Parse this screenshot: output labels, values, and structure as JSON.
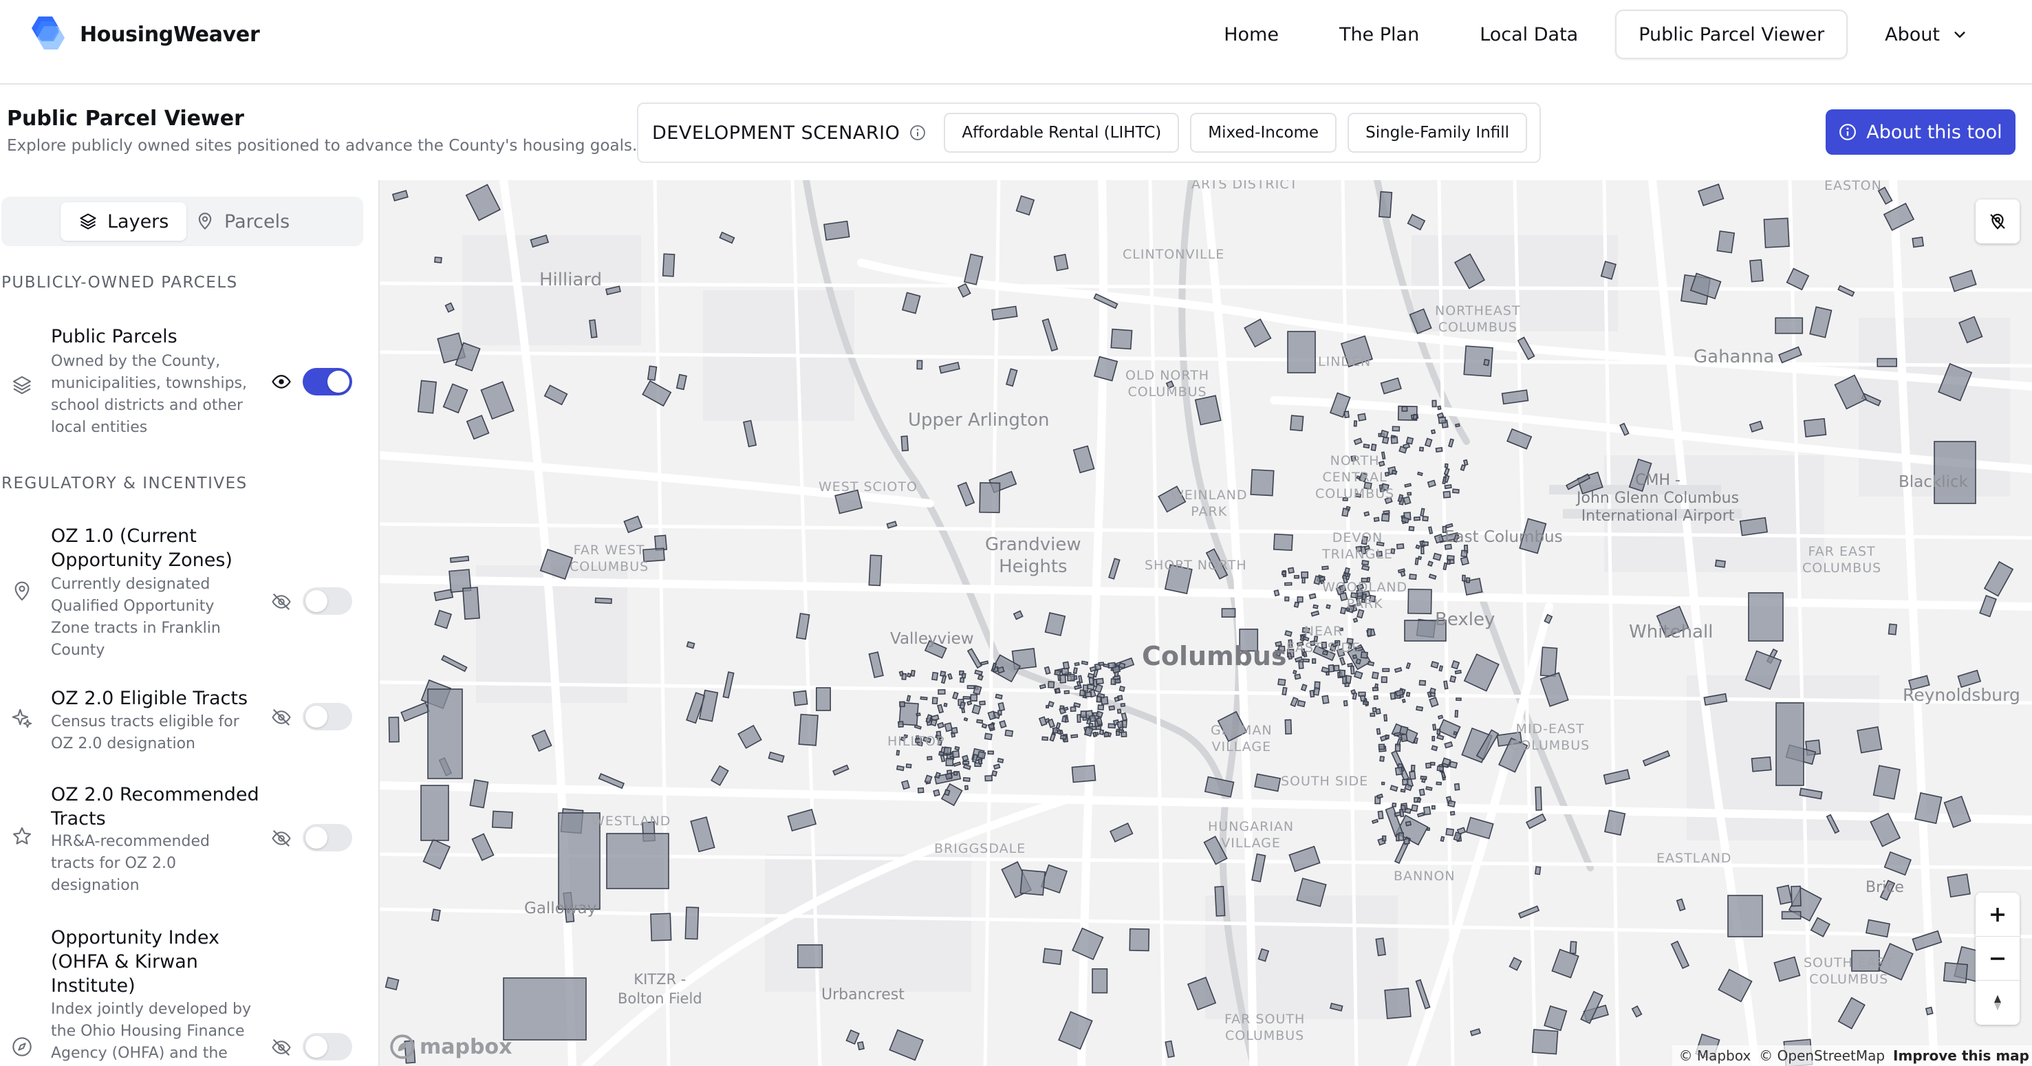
{
  "brand": {
    "name": "HousingWeaver",
    "logo_icon": "hexagon-logo-icon"
  },
  "nav": {
    "items": [
      {
        "label": "Home"
      },
      {
        "label": "The Plan"
      },
      {
        "label": "Local Data"
      },
      {
        "label": "Public Parcel Viewer",
        "active": true
      },
      {
        "label": "About",
        "has_dropdown": true
      }
    ]
  },
  "header": {
    "title": "Public Parcel Viewer",
    "subtitle": "Explore publicly owned sites positioned to advance the County's housing goals.",
    "scenario_label": "DEVELOPMENT SCENARIO",
    "scenarios": [
      "Affordable Rental (LIHTC)",
      "Mixed-Income",
      "Single-Family Infill"
    ],
    "about_button": "About this tool"
  },
  "sidebar": {
    "tabs": [
      {
        "label": "Layers",
        "icon": "layers-icon",
        "active": true
      },
      {
        "label": "Parcels",
        "icon": "map-pin-icon",
        "active": false
      }
    ],
    "sections": [
      {
        "heading": "PUBLICLY-OWNED PARCELS",
        "layers": [
          {
            "title": "Public Parcels",
            "desc": "Owned by the County, municipalities, townships, school districts and other local entities",
            "icon": "layers-icon",
            "visible": true
          }
        ]
      },
      {
        "heading": "REGULATORY & INCENTIVES",
        "layers": [
          {
            "title": "OZ 1.0 (Current Opportunity Zones)",
            "desc": "Currently designated Qualified Opportunity Zone tracts in Franklin County",
            "icon": "map-pin-icon",
            "visible": false
          },
          {
            "title": "OZ 2.0 Eligible Tracts",
            "desc": "Census tracts eligible for OZ 2.0 designation",
            "icon": "sparkle-icon",
            "visible": false
          },
          {
            "title": "OZ 2.0 Recommended Tracts",
            "desc": "HR&A-recommended tracts for OZ 2.0 designation",
            "icon": "star-icon",
            "visible": false
          },
          {
            "title": "Opportunity Index (OHFA & Kirwan Institute)",
            "desc": "Index jointly developed by the Ohio Housing Finance Agency (OHFA) and the",
            "icon": "compass-icon",
            "visible": false
          }
        ]
      }
    ]
  },
  "map": {
    "labels": {
      "arts_district": "ARTS DISTRICT",
      "easton": "EASTON",
      "clintonville": "CLINTONVILLE",
      "hilliard": "Hilliard",
      "northeast_columbus": "NORTHEAST\nCOLUMBUS",
      "linden": "LINDEN",
      "gahanna": "Gahanna",
      "old_north_columbus": "OLD NORTH\nCOLUMBUS",
      "upper_arlington": "Upper Arlington",
      "west_scioto": "WEST SCIOTO",
      "weinland_park": "WEINLAND\nPARK",
      "north_central": "NORTH\nCENTRAL\nCOLUMBUS",
      "cmh": "CMH -\nJohn Glenn Columbus\nInternational Airport",
      "blacklick": "Blacklick",
      "far_west": "FAR WEST\nCOLUMBUS",
      "grandview": "Grandview\nHeights",
      "short_north": "SHORT NORTH",
      "devon_triangle": "DEVON\nTRIANGLE",
      "east_columbus": "East Columbus",
      "far_east": "FAR EAST\nCOLUMBUS",
      "woodland_park": "WOODLAND\nPARK",
      "bexley": "Bexley",
      "whitehall": "Whitehall",
      "valleyview": "Valleyview",
      "columbus": "Columbus",
      "near_east": "NEAR\nEAST SIDE",
      "reynoldsburg": "Reynoldsburg",
      "hilltop": "HILLTOP",
      "german_village": "GERMAN\nVILLAGE",
      "mid_east": "MID-EAST\nCOLUMBUS",
      "south_side": "SOUTH SIDE",
      "westland": "WESTLAND",
      "briggsdale": "BRIGGSDALE",
      "hungarian_village": "HUNGARIAN\nVILLAGE",
      "eastland": "EASTLAND",
      "bannon": "BANNON",
      "brice": "Brice",
      "galloway": "Galloway",
      "south_east": "SOUTH EAST\nCOLUMBUS",
      "kitzr": "KITZR -\nBolton Field",
      "urbancrest": "Urbancrest",
      "far_south": "FAR SOUTH\nCOLUMBUS"
    },
    "controls": [
      "zoom-in-icon",
      "zoom-out-icon",
      "compass-north-icon"
    ],
    "attribution": [
      "© Mapbox",
      "© OpenStreetMap",
      "Improve this map"
    ],
    "logo": "mapbox"
  },
  "colors": {
    "accent": "#3d4bd6",
    "parcel_fill": "#8a8f9c",
    "parcel_stroke": "#3d4250",
    "map_bg": "#f2f2f3",
    "roads": "#ffffff"
  }
}
